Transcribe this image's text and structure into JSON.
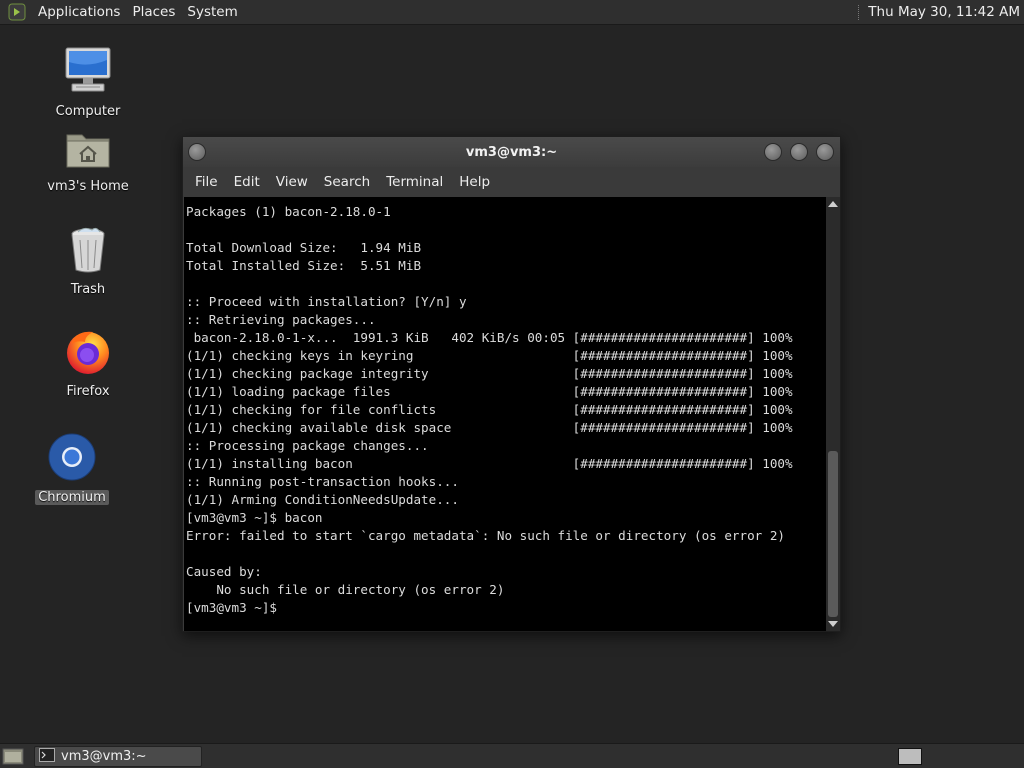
{
  "top_panel": {
    "menus": [
      "Applications",
      "Places",
      "System"
    ],
    "clock": "Thu May 30, 11:42 AM"
  },
  "desktop": {
    "icons": [
      {
        "label": "Computer",
        "icon": "computer-icon"
      },
      {
        "label": "vm3's Home",
        "icon": "home-folder-icon"
      },
      {
        "label": "Trash",
        "icon": "trash-icon"
      },
      {
        "label": "Firefox",
        "icon": "firefox-icon"
      },
      {
        "label": "Chromium",
        "icon": "chromium-icon"
      }
    ]
  },
  "terminal": {
    "title": "vm3@vm3:~",
    "menu": [
      "File",
      "Edit",
      "View",
      "Search",
      "Terminal",
      "Help"
    ],
    "lines": [
      "Packages (1) bacon-2.18.0-1",
      "",
      "Total Download Size:   1.94 MiB",
      "Total Installed Size:  5.51 MiB",
      "",
      ":: Proceed with installation? [Y/n] y",
      ":: Retrieving packages...",
      " bacon-2.18.0-1-x...  1991.3 KiB   402 KiB/s 00:05 [######################] 100%",
      "(1/1) checking keys in keyring                     [######################] 100%",
      "(1/1) checking package integrity                   [######################] 100%",
      "(1/1) loading package files                        [######################] 100%",
      "(1/1) checking for file conflicts                  [######################] 100%",
      "(1/1) checking available disk space                [######################] 100%",
      ":: Processing package changes...",
      "(1/1) installing bacon                             [######################] 100%",
      ":: Running post-transaction hooks...",
      "(1/1) Arming ConditionNeedsUpdate...",
      "[vm3@vm3 ~]$ bacon",
      "Error: failed to start `cargo metadata`: No such file or directory (os error 2)",
      "",
      "Caused by:",
      "    No such file or directory (os error 2)",
      "[vm3@vm3 ~]$"
    ]
  },
  "bottom_panel": {
    "task_label": "vm3@vm3:~"
  },
  "colors": {
    "desktop_bg": "#242424",
    "panel_bg": "#2f2f2f",
    "terminal_bg": "#000000",
    "terminal_fg": "#dcdcdc"
  }
}
